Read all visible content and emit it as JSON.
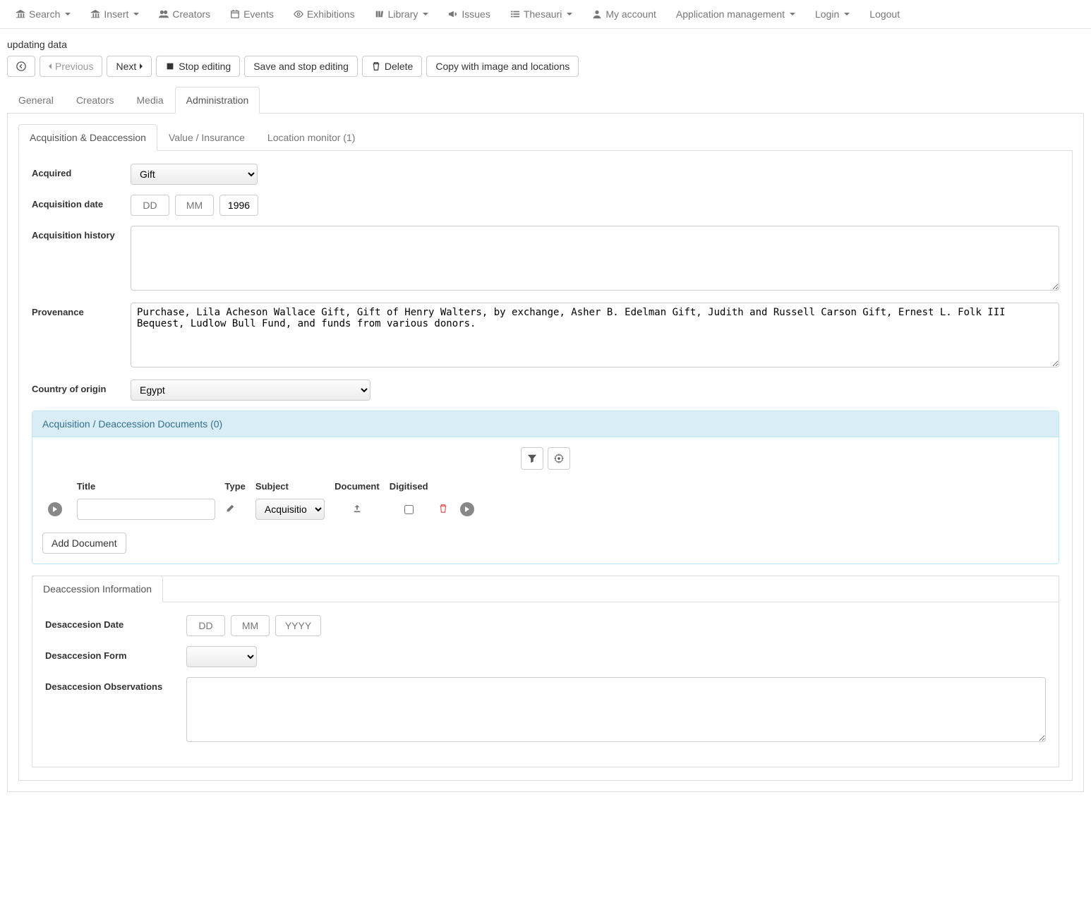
{
  "topnav": {
    "search": "Search",
    "insert": "Insert",
    "creators": "Creators",
    "events": "Events",
    "exhibitions": "Exhibitions",
    "library": "Library",
    "issues": "Issues",
    "thesauri": "Thesauri",
    "my_account": "My account",
    "app_management": "Application management",
    "login": "Login",
    "logout": "Logout"
  },
  "status": "updating data",
  "toolbar": {
    "previous": "Previous",
    "next": "Next",
    "stop_editing": "Stop editing",
    "save_stop": "Save and stop editing",
    "delete": "Delete",
    "copy": "Copy with image and locations"
  },
  "main_tabs": {
    "general": "General",
    "creators": "Creators",
    "media": "Media",
    "administration": "Administration"
  },
  "sub_tabs": {
    "acq_deacc": "Acquisition & Deaccession",
    "value_ins": "Value / Insurance",
    "loc_monitor": "Location monitor (1)"
  },
  "form": {
    "acquired_label": "Acquired",
    "acquired_value": "Gift",
    "acq_date_label": "Acquisition date",
    "acq_date_dd_ph": "DD",
    "acq_date_mm_ph": "MM",
    "acq_date_yyyy": "1996",
    "acq_history_label": "Acquisition history",
    "acq_history_value": "",
    "provenance_label": "Provenance",
    "provenance_value": "Purchase, Lila Acheson Wallace Gift, Gift of Henry Walters, by exchange, Asher B. Edelman Gift, Judith and Russell Carson Gift, Ernest L. Folk III Bequest, Ludlow Bull Fund, and funds from various donors.",
    "country_label": "Country of origin",
    "country_value": "Egypt"
  },
  "documents": {
    "header": "Acquisition / Deaccession Documents (0)",
    "cols": {
      "title": "Title",
      "type": "Type",
      "subject": "Subject",
      "document": "Document",
      "digitised": "Digitised"
    },
    "subject_value": "Acquisition",
    "add_btn": "Add Document"
  },
  "deacc": {
    "tab": "Deaccession Information",
    "date_label": "Desaccesion Date",
    "date_dd_ph": "DD",
    "date_mm_ph": "MM",
    "date_yyyy_ph": "YYYY",
    "form_label": "Desaccesion Form",
    "obs_label": "Desaccesion Observations"
  }
}
